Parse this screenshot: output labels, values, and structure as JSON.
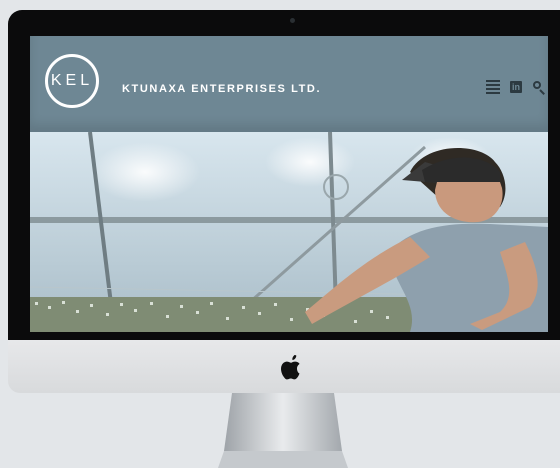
{
  "site": {
    "logo_text": "KEL",
    "company_name": "KTUNAXA ENTERPRISES LTD."
  },
  "header_icons": {
    "menu": "menu-icon",
    "linkedin": "linkedin-icon",
    "linkedin_glyph": "in",
    "search": "search-icon"
  },
  "device": {
    "logo": "apple-logo"
  },
  "colors": {
    "header_bg": "#6e8794",
    "header_text": "#ffffff",
    "icon_color": "#2c3a41",
    "bezel": "#0b0b0c",
    "chin": "#dcdee0"
  }
}
